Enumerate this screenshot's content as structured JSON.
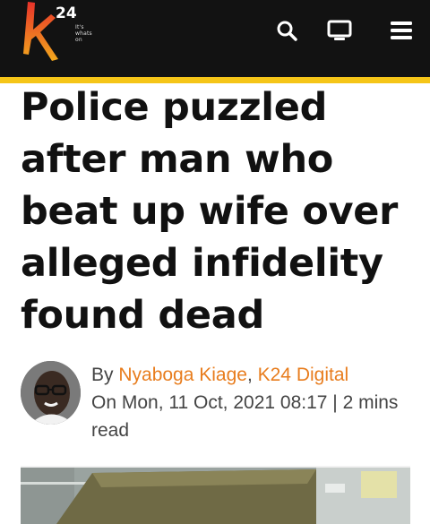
{
  "header": {
    "logo_text": "24",
    "logo_tagline": "It's whats on",
    "icons": [
      "search-icon",
      "tv-icon",
      "menu-icon"
    ]
  },
  "colors": {
    "header_bg": "#121212",
    "accent": "#f5c518",
    "brand_orange": "#e87d1e"
  },
  "article": {
    "title": "Police puzzled after man who beat up wife over alleged infidelity found dead",
    "byline": {
      "by": "By ",
      "author": "Nyaboga Kiage",
      "separator": ", ",
      "outlet": "K24 Digital",
      "date": "On Mon, 11 Oct, 2021 08:17 | 2 mins read"
    }
  }
}
